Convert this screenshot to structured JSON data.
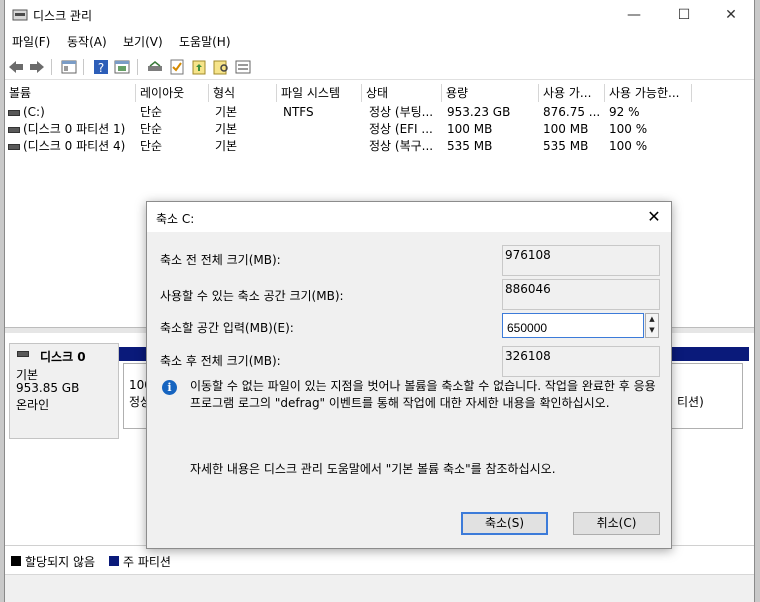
{
  "window": {
    "title": "디스크 관리",
    "controls": {
      "minimize": "—",
      "maximize": "☐",
      "close": "✕"
    }
  },
  "menu": [
    "파일(F)",
    "동작(A)",
    "보기(V)",
    "도움말(H)"
  ],
  "volume_table": {
    "headers": [
      "볼륨",
      "레이아웃",
      "형식",
      "파일 시스템",
      "상태",
      "용량",
      "사용 가...",
      "사용 가능한..."
    ],
    "rows": [
      [
        "(C:)",
        "단순",
        "기본",
        "NTFS",
        "정상 (부팅...",
        "953.23 GB",
        "876.75 ...",
        "92 %"
      ],
      [
        "(디스크 0 파티션 1)",
        "단순",
        "기본",
        "",
        "정상 (EFI ...",
        "100 MB",
        "100 MB",
        "100 %"
      ],
      [
        "(디스크 0 파티션 4)",
        "단순",
        "기본",
        "",
        "정상 (복구...",
        "535 MB",
        "535 MB",
        "100 %"
      ]
    ]
  },
  "disk": {
    "name": "디스크 0",
    "type": "기본",
    "size": "953.85 GB",
    "status": "온라인",
    "partition_text_1": "100",
    "partition_text_2": "정상",
    "partition_text_right": "티션)"
  },
  "legend": {
    "unallocated": "할당되지 않음",
    "primary": "주 파티션"
  },
  "dialog": {
    "title": "축소 C:",
    "fields": [
      {
        "label": "축소 전 전체 크기(MB):",
        "value": "976108"
      },
      {
        "label": "사용할 수 있는 축소 공간 크기(MB):",
        "value": "886046"
      },
      {
        "label": "축소할 공간 입력(MB)(E):",
        "value": "650000"
      },
      {
        "label": "축소 후 전체 크기(MB):",
        "value": "326108"
      }
    ],
    "info_icon": "i",
    "info_text": "이동할 수 없는 파일이 있는 지점을 벗어나 볼륨을 축소할 수 없습니다. 작업을 완료한 후 응용 프로그램 로그의 \"defrag\" 이벤트를 통해 작업에 대한 자세한 내용을 확인하십시오.",
    "help_text": "자세한 내용은 디스크 관리 도움말에서 \"기본 볼륨 축소\"를 참조하십시오.",
    "shrink_button": "축소(S)",
    "cancel_button": "취소(C)",
    "close": "✕"
  },
  "colors": {
    "primary_partition": "#0a1a7a",
    "unallocated": "#000000",
    "focus": "#3c7bd9"
  }
}
